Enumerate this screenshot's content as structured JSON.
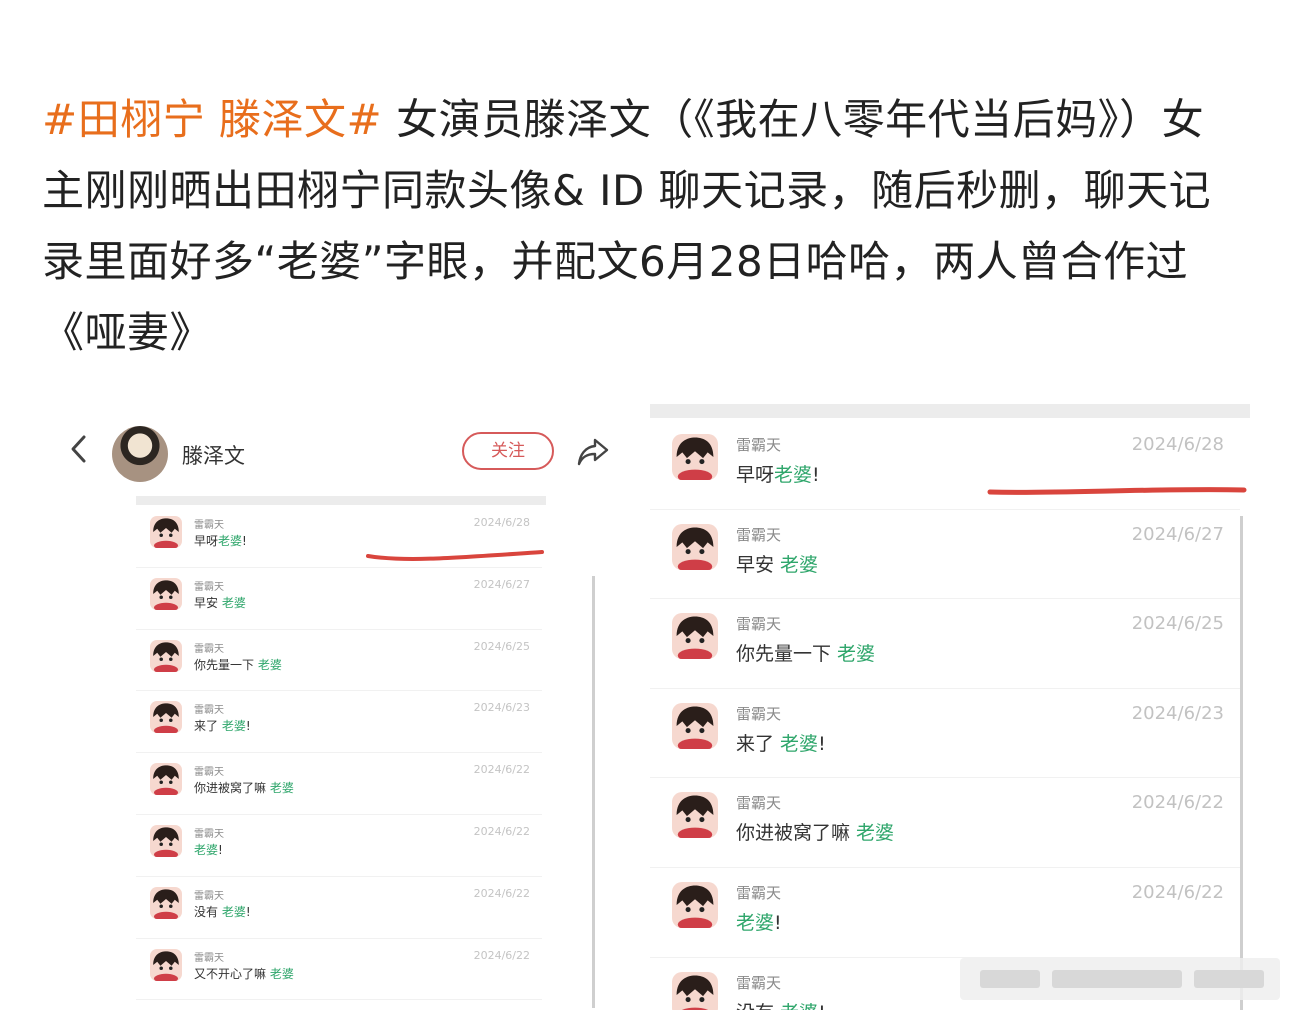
{
  "post": {
    "tag": "#田栩宁 滕泽文#",
    "body": " 女演员滕泽文（《我在八零年代当后妈》）女主刚刚晒出田栩宁同款头像& ID 聊天记录，随后秒删，聊天记录里面好多“老婆”字眼，并配文6月28日哈哈，两人曾合作过《哑妻》"
  },
  "left_screenshot": {
    "back_icon": "chevron-left-icon",
    "profile_name": "滕泽文",
    "follow_label": "关注",
    "share_icon": "share-arrow-icon",
    "messages": [
      {
        "sender": "雷霸天",
        "prefix": "早呀",
        "highlight": "老婆",
        "suffix": "!",
        "date": "2024/6/28"
      },
      {
        "sender": "雷霸天",
        "prefix": "早安 ",
        "highlight": "老婆",
        "suffix": "",
        "date": "2024/6/27"
      },
      {
        "sender": "雷霸天",
        "prefix": "你先量一下 ",
        "highlight": "老婆",
        "suffix": "",
        "date": "2024/6/25"
      },
      {
        "sender": "雷霸天",
        "prefix": "来了 ",
        "highlight": "老婆",
        "suffix": "!",
        "date": "2024/6/23"
      },
      {
        "sender": "雷霸天",
        "prefix": "你进被窝了嘛 ",
        "highlight": "老婆",
        "suffix": "",
        "date": "2024/6/22"
      },
      {
        "sender": "雷霸天",
        "prefix": "",
        "highlight": "老婆",
        "suffix": "!",
        "date": "2024/6/22"
      },
      {
        "sender": "雷霸天",
        "prefix": "没有 ",
        "highlight": "老婆",
        "suffix": "!",
        "date": "2024/6/22"
      },
      {
        "sender": "雷霸天",
        "prefix": "又不开心了嘛 ",
        "highlight": "老婆",
        "suffix": "",
        "date": "2024/6/22"
      }
    ]
  },
  "right_screenshot": {
    "messages": [
      {
        "sender": "雷霸天",
        "prefix": "早呀",
        "highlight": "老婆",
        "suffix": "!",
        "date": "2024/6/28"
      },
      {
        "sender": "雷霸天",
        "prefix": "早安 ",
        "highlight": "老婆",
        "suffix": "",
        "date": "2024/6/27"
      },
      {
        "sender": "雷霸天",
        "prefix": "你先量一下 ",
        "highlight": "老婆",
        "suffix": "",
        "date": "2024/6/25"
      },
      {
        "sender": "雷霸天",
        "prefix": "来了 ",
        "highlight": "老婆",
        "suffix": "!",
        "date": "2024/6/23"
      },
      {
        "sender": "雷霸天",
        "prefix": "你进被窝了嘛 ",
        "highlight": "老婆",
        "suffix": "",
        "date": "2024/6/22"
      },
      {
        "sender": "雷霸天",
        "prefix": "",
        "highlight": "老婆",
        "suffix": "!",
        "date": "2024/6/22"
      },
      {
        "sender": "雷霸天",
        "prefix": "没有 ",
        "highlight": "老婆",
        "suffix": "!",
        "date": ""
      }
    ]
  },
  "colors": {
    "hashtag": "#e86e1c",
    "highlight_word": "#2fa66b",
    "follow_button": "#d65a5a",
    "annotation_mark": "#d9453d"
  }
}
